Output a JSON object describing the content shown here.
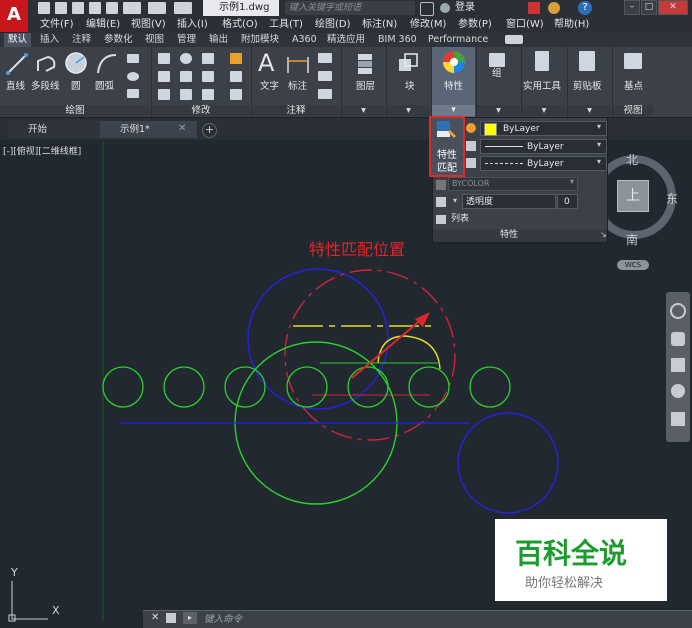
{
  "app": {
    "logo": "A",
    "doc_title": "示例1.dwg",
    "search_placeholder": "键入关键字或短语",
    "login_label": "登录",
    "help_label": "?"
  },
  "menu": [
    "文件(F)",
    "编辑(E)",
    "视图(V)",
    "插入(I)",
    "格式(O)",
    "工具(T)",
    "绘图(D)",
    "标注(N)",
    "修改(M)",
    "参数(P)",
    "窗口(W)",
    "帮助(H)"
  ],
  "ribbon_tabs": [
    "默认",
    "插入",
    "注释",
    "参数化",
    "视图",
    "管理",
    "输出",
    "附加模块",
    "A360",
    "精选应用",
    "BIM 360",
    "Performance"
  ],
  "ribbon": {
    "draw_tools": [
      "直线",
      "多段线",
      "圆",
      "圆弧"
    ],
    "draw_panel": "绘图",
    "modify_panel": "修改",
    "annot_tools": [
      "文字",
      "标注"
    ],
    "annot_panel": "注释",
    "layer_label": "图层",
    "block_label": "块",
    "props_label": "特性",
    "group_label": "组",
    "util_label": "实用工具",
    "clip_label": "剪贴板",
    "base_label": "基点",
    "view_panel": "视图"
  },
  "file_tabs": [
    "开始",
    "示例1*"
  ],
  "viewport_label": "[-][俯视][二维线框]",
  "properties_panel": {
    "match_label_line1": "特性",
    "match_label_line2": "匹配",
    "color": "ByLayer",
    "linetype": "ByLayer",
    "lineweight": "ByLayer",
    "plotstyle": "BYCOLOR",
    "transparency_label": "透明度",
    "transparency_value": "0",
    "list_label": "列表",
    "footer": "特性"
  },
  "annotation": {
    "text": "特性匹配位置",
    "color": "#e0262a"
  },
  "viewcube": {
    "north": "北",
    "east": "东",
    "south": "南",
    "top": "上",
    "wcs": "WCS"
  },
  "ucs": {
    "y": "Y",
    "x": "X"
  },
  "command": {
    "placeholder": "键入命令"
  },
  "watermark": {
    "title": "百科全说",
    "subtitle": "助你轻松解决"
  },
  "colors": {
    "green": "#2bd12b",
    "blue": "#1a1ae0",
    "red": "#d8233a",
    "yellow": "#e6e61e"
  }
}
